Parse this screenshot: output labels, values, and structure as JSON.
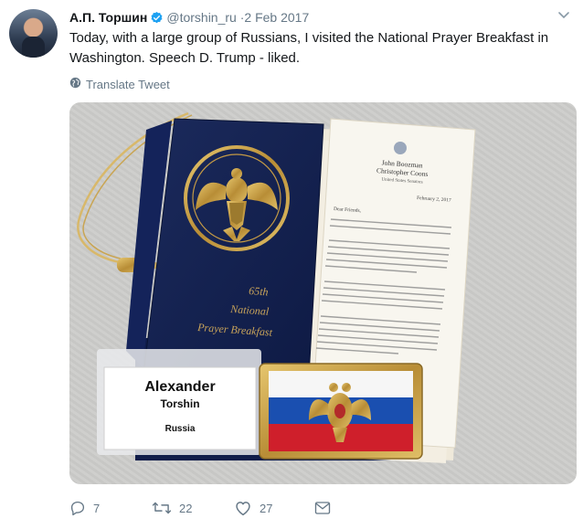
{
  "tweet": {
    "display_name": "А.П. Торшин",
    "handle": "@torshin_ru",
    "separator": "·",
    "date": "2 Feb 2017",
    "text": "Today, with a large group of Russians, I visited the National Prayer Breakfast in Washington. Speech D. Trump - liked.",
    "translate_label": "Translate Tweet",
    "verified_color": "#1da1f2"
  },
  "photo": {
    "program_title_line1": "65th",
    "program_title_line2": "National",
    "program_title_line3": "Prayer Breakfast",
    "letter_header_line1": "John Boozman",
    "letter_header_line2": "Christopher Coons",
    "letter_header_line3": "United States Senators",
    "letter_date": "February 2, 2017",
    "letter_salutation": "Dear Friends,",
    "badge_first_name": "Alexander",
    "badge_last_name": "Torshin",
    "badge_country": "Russia"
  },
  "actions": {
    "replies": "7",
    "retweets": "22",
    "likes": "27",
    "icons": [
      "reply-icon",
      "retweet-icon",
      "like-icon",
      "message-icon"
    ]
  }
}
